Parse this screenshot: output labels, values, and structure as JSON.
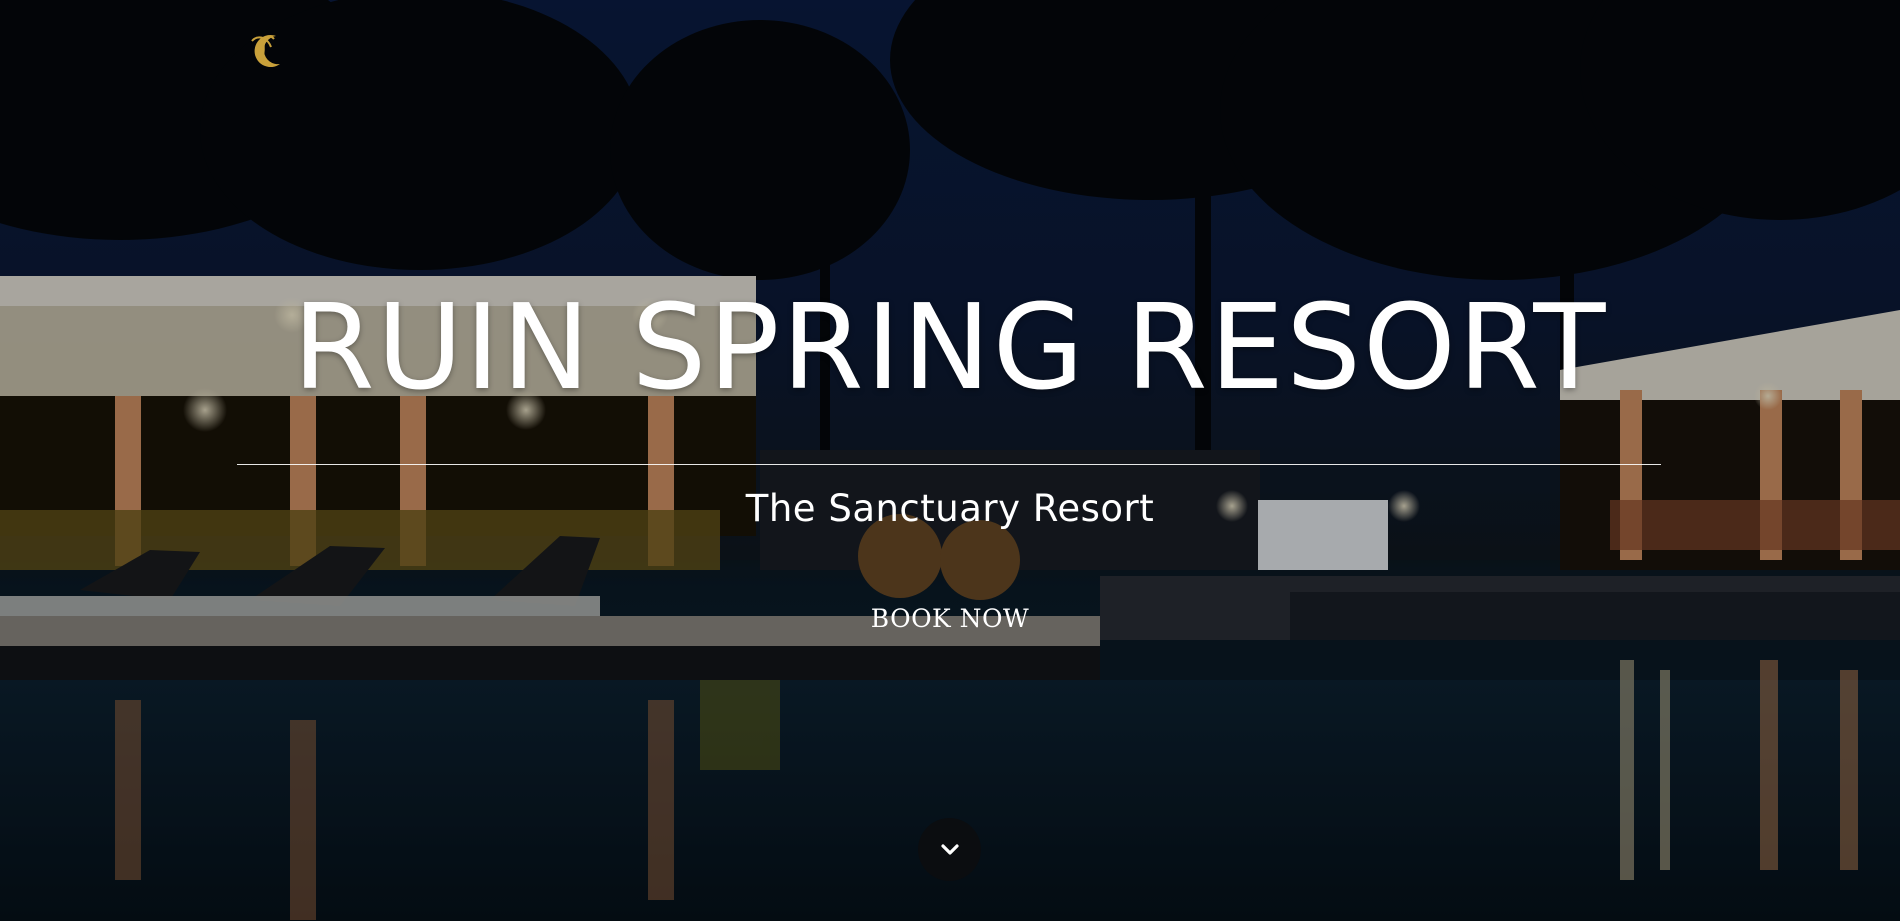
{
  "hero": {
    "title": "RUIN SPRING RESORT",
    "subtitle": "The Sanctuary Resort",
    "book_label": "BOOK NOW",
    "logo_icon": "palm-crescent-logo-icon",
    "scroll_icon": "chevron-down-icon"
  },
  "colors": {
    "logo_gold": "#c9a13b",
    "text": "#ffffff",
    "scroll_button": "#0b0d10"
  }
}
